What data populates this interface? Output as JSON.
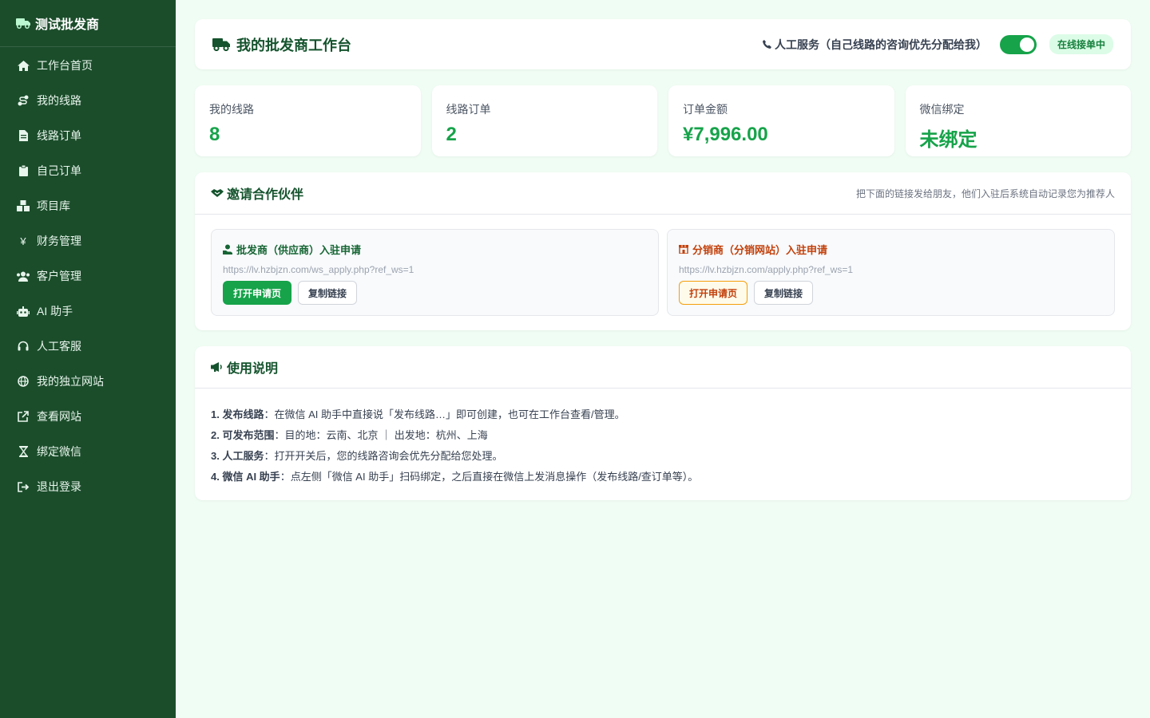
{
  "colors": {
    "sidebar_bg": "#1b4d2b",
    "accent": "#16a34a",
    "page_bg": "#f0fdf4",
    "orange": "#c2410c"
  },
  "sidebar": {
    "brand": "测试批发商",
    "brand_icon": "truck-icon",
    "items": [
      {
        "label": "工作台首页",
        "icon": "home-icon"
      },
      {
        "label": "我的线路",
        "icon": "route-icon"
      },
      {
        "label": "线路订单",
        "icon": "file-icon"
      },
      {
        "label": "自己订单",
        "icon": "clipboard-icon"
      },
      {
        "label": "项目库",
        "icon": "boxes-icon"
      },
      {
        "label": "财务管理",
        "icon": "yen-icon"
      },
      {
        "label": "客户管理",
        "icon": "users-icon"
      },
      {
        "label": "AI 助手",
        "icon": "robot-icon"
      },
      {
        "label": "人工客服",
        "icon": "headset-icon"
      },
      {
        "label": "我的独立网站",
        "icon": "globe-icon"
      },
      {
        "label": "查看网站",
        "icon": "external-link-icon"
      },
      {
        "label": "绑定微信",
        "icon": "hourglass-icon"
      },
      {
        "label": "退出登录",
        "icon": "logout-icon"
      }
    ]
  },
  "header": {
    "title": "我的批发商工作台",
    "service_label": "人工服务（自己线路的咨询优先分配给我）",
    "toggle_on": true,
    "status_badge": "在线接单中"
  },
  "stats": [
    {
      "label": "我的线路",
      "value": "8"
    },
    {
      "label": "线路订单",
      "value": "2"
    },
    {
      "label": "订单金额",
      "value": "¥7,996.00"
    },
    {
      "label": "微信绑定",
      "value": "未绑定"
    }
  ],
  "invite": {
    "title": "邀请合作伙伴",
    "hint": "把下面的链接发给朋友，他们入驻后系统自动记录您为推荐人",
    "wholesaler": {
      "title": "批发商（供应商）入驻申请",
      "url": "https://lv.hzbjzn.com/ws_apply.php?ref_ws=1",
      "open_label": "打开申请页",
      "copy_label": "复制链接"
    },
    "distributor": {
      "title": "分销商（分销网站）入驻申请",
      "url": "https://lv.hzbjzn.com/apply.php?ref_ws=1",
      "open_label": "打开申请页",
      "copy_label": "复制链接"
    }
  },
  "usage": {
    "title": "使用说明",
    "lines": [
      {
        "head": "1. 发布线路",
        "text": "：在微信 AI 助手中直接说「发布线路…」即可创建，也可在工作台查看/管理。"
      },
      {
        "head": "2. 可发布范围",
        "text": "：目的地：云南、北京 ｜ 出发地：杭州、上海"
      },
      {
        "head": "3. 人工服务",
        "text": "：打开开关后，您的线路咨询会优先分配给您处理。"
      },
      {
        "head": "4. 微信 AI 助手",
        "text": "：点左侧「微信 AI 助手」扫码绑定，之后直接在微信上发消息操作（发布线路/查订单等）。"
      }
    ]
  }
}
